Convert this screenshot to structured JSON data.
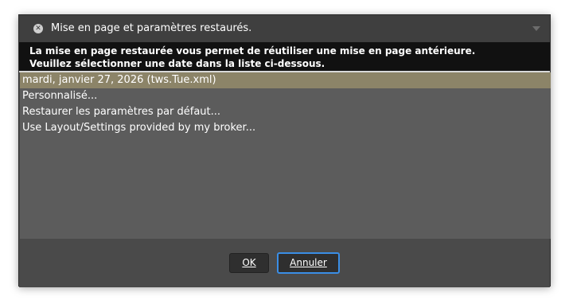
{
  "window": {
    "title": "Mise en page et paramètres restaurés."
  },
  "icons": {
    "close": "close-icon",
    "collapse": "chevron-down-icon"
  },
  "info": {
    "line1": "La mise en page restaurée vous permet de réutiliser une mise en page antérieure.",
    "line2": "Veuillez sélectionner une date dans la liste ci-dessous."
  },
  "list": {
    "items": [
      {
        "label": "mardi, janvier 27, 2026 (tws.Tue.xml)",
        "selected": true
      },
      {
        "label": "Personnalisé...",
        "selected": false
      },
      {
        "label": "Restaurer les paramètres par défaut...",
        "selected": false
      },
      {
        "label": "Use Layout/Settings provided by my broker...",
        "selected": false
      }
    ]
  },
  "buttons": {
    "ok_label": "OK",
    "cancel_label": "Annuler"
  },
  "colors": {
    "selection": "#8c8468",
    "focus_ring": "#3a8ee6",
    "info_background": "#111111"
  }
}
